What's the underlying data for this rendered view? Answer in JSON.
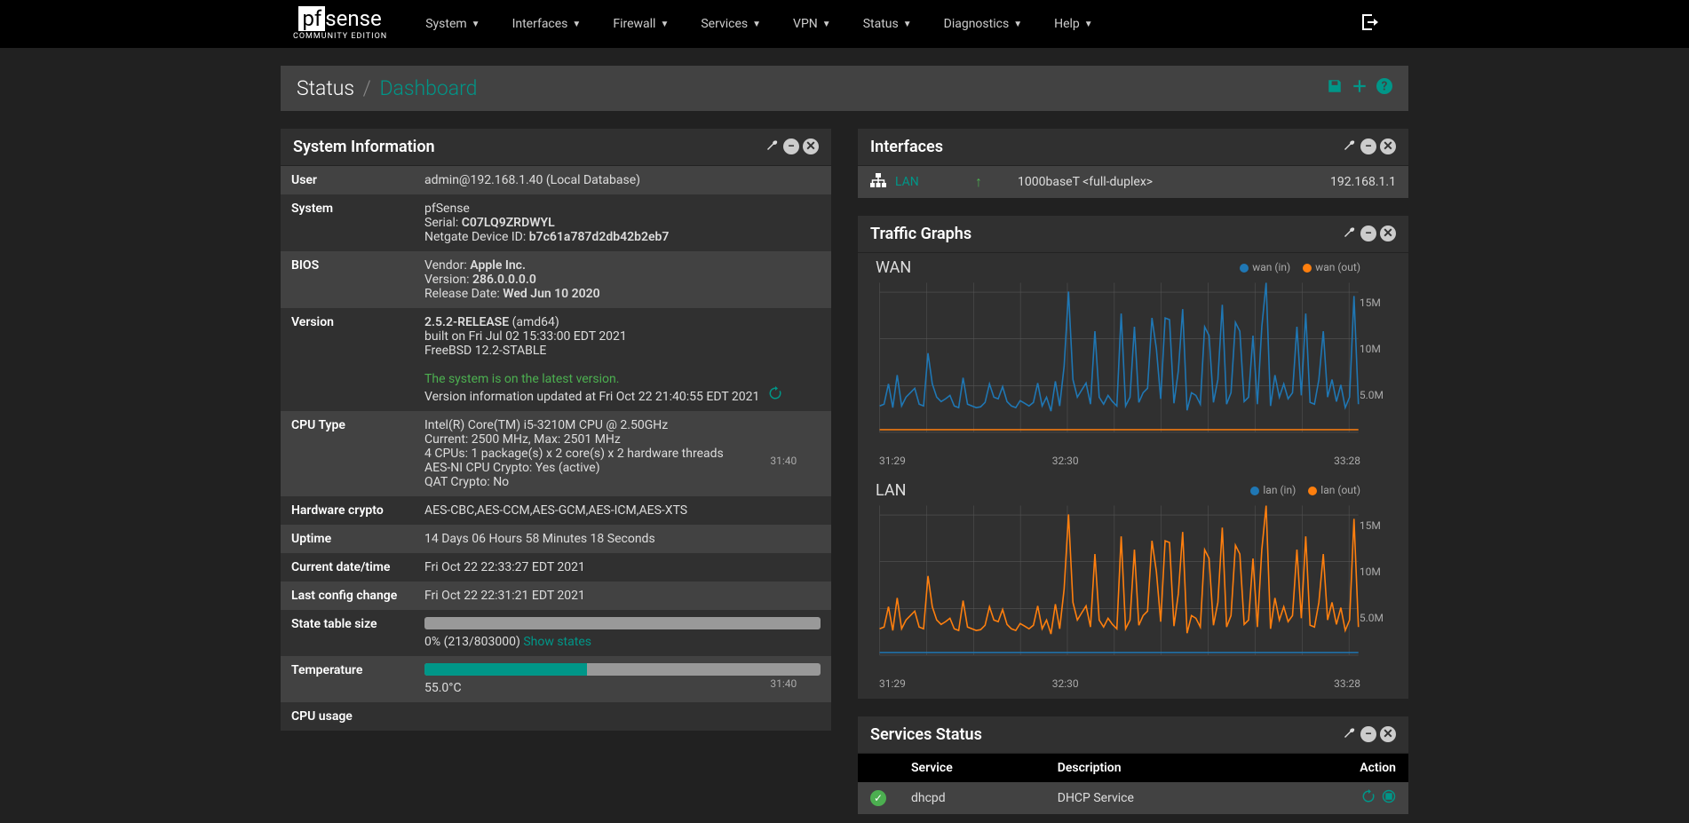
{
  "nav": {
    "brand_main_white": "pf",
    "brand_main_black": "sense",
    "brand_sub": "COMMUNITY EDITION",
    "items": [
      "System",
      "Interfaces",
      "Firewall",
      "Services",
      "VPN",
      "Status",
      "Diagnostics",
      "Help"
    ]
  },
  "breadcrumb": {
    "section": "Status",
    "page": "Dashboard"
  },
  "sysinfo": {
    "title": "System Information",
    "user_label": "User",
    "user": "admin@192.168.1.40 (Local Database)",
    "system_label": "System",
    "system_name": "pfSense",
    "serial_label": "Serial: ",
    "serial": "C07LQ9ZRDWYL",
    "ndid_label": "Netgate Device ID: ",
    "ndid": "b7c61a787d2db42b2eb7",
    "bios_label": "BIOS",
    "bios_vendor_label": "Vendor: ",
    "bios_vendor": "Apple Inc.",
    "bios_version_label": "Version: ",
    "bios_version": "286.0.0.0.0",
    "bios_date_label": "Release Date: ",
    "bios_date": "Wed Jun 10 2020",
    "version_label": "Version",
    "version_rel": "2.5.2-RELEASE",
    "version_arch": " (amd64)",
    "version_built": "built on Fri Jul 02 15:33:00 EDT 2021",
    "version_os": "FreeBSD 12.2-STABLE",
    "version_status": "The system is on the latest version.",
    "version_updated": "Version information updated at Fri Oct 22 21:40:55 EDT 2021",
    "cpu_label": "CPU Type",
    "cpu_model": "Intel(R) Core(TM) i5-3210M CPU @ 2.50GHz",
    "cpu_freq": "Current: 2500 MHz, Max: 2501 MHz",
    "cpu_cores": "4 CPUs: 1 package(s) x 2 core(s) x 2 hardware threads",
    "cpu_aesni": "AES-NI CPU Crypto: Yes (active)",
    "cpu_qat": "QAT Crypto: No",
    "hwcrypto_label": "Hardware crypto",
    "hwcrypto": "AES-CBC,AES-CCM,AES-GCM,AES-ICM,AES-XTS",
    "uptime_label": "Uptime",
    "uptime": "14 Days 06 Hours 58 Minutes 18 Seconds",
    "date_label": "Current date/time",
    "date": "Fri Oct 22 22:33:27 EDT 2021",
    "lastcfg_label": "Last config change",
    "lastcfg": "Fri Oct 22 22:31:21 EDT 2021",
    "state_label": "State table size",
    "state_pct": 0,
    "state_text": "0% (213/803000) ",
    "state_link": "Show states",
    "temp_label": "Temperature",
    "temp_pct": 41,
    "temp_text": "55.0°C",
    "cpuusage_label": "CPU usage"
  },
  "interfaces": {
    "title": "Interfaces",
    "rows": [
      {
        "name": "LAN",
        "status": "up",
        "speed": "1000baseT <full-duplex>",
        "ip": "192.168.1.1"
      }
    ]
  },
  "traffic": {
    "title": "Traffic Graphs",
    "graphs": [
      {
        "name": "WAN",
        "legend_in": "wan (in)",
        "legend_out": "wan (out)"
      },
      {
        "name": "LAN",
        "legend_in": "lan (in)",
        "legend_out": "lan (out)"
      }
    ],
    "ylabels": [
      "15M",
      "10M",
      "5.0M"
    ],
    "xlabels": [
      "31:29",
      "31:40",
      "32:30",
      "33:28"
    ]
  },
  "services": {
    "title": "Services Status",
    "cols": {
      "service": "Service",
      "desc": "Description",
      "action": "Action"
    },
    "rows": [
      {
        "name": "dhcpd",
        "desc": "DHCP Service",
        "status": "ok"
      }
    ]
  },
  "chart_data": [
    {
      "type": "line",
      "title": "WAN",
      "x_range": [
        "31:29",
        "33:28"
      ],
      "ylim": [
        0,
        17000000
      ],
      "ylabel": "",
      "series": [
        {
          "name": "wan (in)",
          "color": "#1f77b4",
          "values": [
            3.0,
            3.2,
            5.5,
            2.8,
            6.5,
            3.0,
            4.0,
            4.5,
            5.0,
            3.2,
            3.0,
            9.0,
            5.5,
            4.0,
            3.5,
            3.8,
            4.2,
            3.0,
            2.8,
            6.2,
            3.2,
            3.0,
            2.8,
            2.9,
            3.4,
            5.5,
            4.0,
            3.8,
            5.2,
            3.5,
            3.0,
            2.8,
            3.6,
            3.3,
            3.0,
            3.4,
            5.6,
            3.0,
            4.0,
            2.4,
            5.8,
            3.0,
            7.5,
            16.0,
            6.0,
            4.0,
            4.8,
            5.6,
            3.2,
            11.5,
            4.0,
            3.2,
            4.2,
            3.5,
            3.0,
            13.5,
            3.0,
            4.0,
            12.0,
            3.4,
            4.5,
            5.0,
            13.0,
            9.5,
            3.8,
            13.0,
            12.8,
            3.3,
            7.0,
            14.0,
            2.5,
            4.5,
            4.2,
            3.2,
            12.0,
            11.0,
            3.4,
            6.0,
            14.5,
            3.2,
            4.5,
            12.5,
            11.5,
            3.5,
            4.0,
            11.0,
            3.2,
            12.0,
            17.0,
            3.0,
            6.5,
            4.0,
            5.5,
            3.8,
            4.5,
            12.0,
            4.2,
            13.5,
            3.4,
            3.2,
            6.0,
            11.5,
            4.0,
            6.0,
            3.5,
            5.4,
            2.8,
            4.0,
            15.5,
            3.2
          ],
          "note": "values in millions (M)"
        },
        {
          "name": "wan (out)",
          "color": "#ff7f0e",
          "values_constant": 0.3,
          "note": "approximately flat low line, in M"
        }
      ]
    },
    {
      "type": "line",
      "title": "LAN",
      "x_range": [
        "31:29",
        "33:28"
      ],
      "ylim": [
        0,
        17000000
      ],
      "ylabel": "",
      "series": [
        {
          "name": "lan (in)",
          "color": "#1f77b4",
          "values_constant": 0.3,
          "note": "approximately flat low line, in M"
        },
        {
          "name": "lan (out)",
          "color": "#ff7f0e",
          "values": [
            3.0,
            3.2,
            5.5,
            2.8,
            6.5,
            3.0,
            4.0,
            4.5,
            5.0,
            3.2,
            3.0,
            9.0,
            5.5,
            4.0,
            3.5,
            3.8,
            4.2,
            3.0,
            2.8,
            6.2,
            3.2,
            3.0,
            2.8,
            2.9,
            3.4,
            5.5,
            4.0,
            3.8,
            5.2,
            3.5,
            3.0,
            2.8,
            3.6,
            3.3,
            3.0,
            3.4,
            5.6,
            3.0,
            4.0,
            2.4,
            5.8,
            3.0,
            7.5,
            16.0,
            6.0,
            4.0,
            4.8,
            5.6,
            3.2,
            11.5,
            4.0,
            3.2,
            4.2,
            3.5,
            3.0,
            13.5,
            3.0,
            4.0,
            12.0,
            3.4,
            4.5,
            5.0,
            13.0,
            9.5,
            3.8,
            13.0,
            12.8,
            3.3,
            7.0,
            14.0,
            2.5,
            4.5,
            4.2,
            3.2,
            12.0,
            11.0,
            3.4,
            6.0,
            14.5,
            3.2,
            4.5,
            12.5,
            11.5,
            3.5,
            4.0,
            11.0,
            3.2,
            12.0,
            17.0,
            3.0,
            6.5,
            4.0,
            5.5,
            3.8,
            4.5,
            12.0,
            4.2,
            13.5,
            3.4,
            3.2,
            6.0,
            11.5,
            4.0,
            6.0,
            3.5,
            5.4,
            2.8,
            4.0,
            15.5,
            3.2
          ],
          "note": "values in millions (M)"
        }
      ]
    }
  ]
}
